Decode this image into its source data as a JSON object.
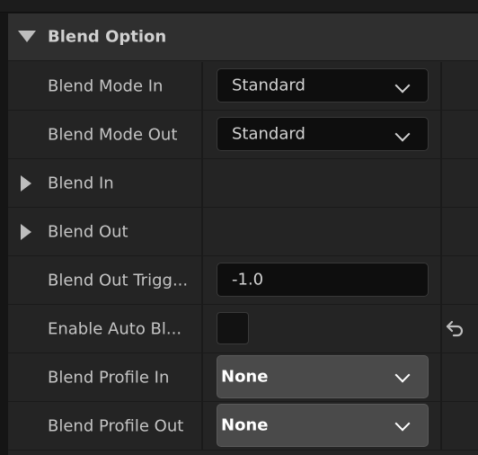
{
  "header": {
    "title": "Blend Option"
  },
  "rows": [
    {
      "label": "Blend Mode In",
      "value": "Standard"
    },
    {
      "label": "Blend Mode Out",
      "value": "Standard"
    },
    {
      "label": "Blend In"
    },
    {
      "label": "Blend Out"
    },
    {
      "label": "Blend Out Trigg...",
      "value": "-1.0"
    },
    {
      "label": "Enable Auto Bl...",
      "checked": false
    },
    {
      "label": "Blend Profile In",
      "value": "None"
    },
    {
      "label": "Blend Profile Out",
      "value": "None"
    }
  ],
  "icons": {
    "header_toggle": "triangle-down-icon",
    "expander": "triangle-right-icon",
    "dropdown": "chevron-down-icon",
    "reset": "undo-arrow-icon"
  },
  "colors": {
    "background": "#151515",
    "panel": "#242424",
    "header": "#2f2f2f",
    "field": "#0e0e0e",
    "field_light": "#4a4a4a"
  }
}
